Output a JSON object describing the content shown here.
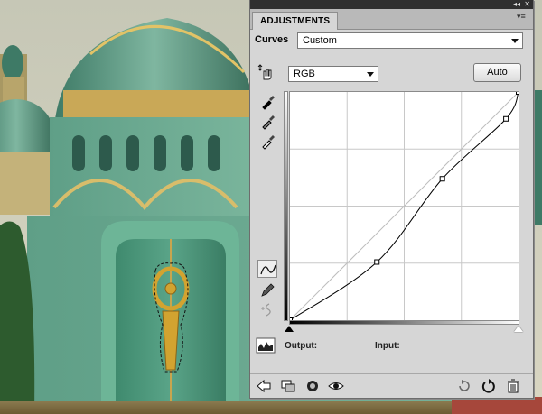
{
  "panel": {
    "tab_title": "ADJUSTMENTS",
    "collapse_glyph": "◂◂",
    "close_glyph": "✕",
    "menu_glyph": "▾≡",
    "preset_label": "Curves",
    "preset_value": "Custom",
    "channel_value": "RGB",
    "auto_label": "Auto",
    "output_label": "Output:",
    "output_value": "",
    "input_label": "Input:",
    "input_value": ""
  },
  "tools": [
    {
      "name": "on-image-adjust-tool",
      "icon": "hand-arrows-icon"
    },
    {
      "name": "black-point-eyedropper",
      "icon": "eyedropper-black-icon"
    },
    {
      "name": "gray-point-eyedropper",
      "icon": "eyedropper-gray-icon"
    },
    {
      "name": "white-point-eyedropper",
      "icon": "eyedropper-white-icon"
    },
    {
      "name": "curve-points-tool",
      "icon": "curve-icon",
      "active": true
    },
    {
      "name": "pencil-draw-tool",
      "icon": "pencil-icon"
    },
    {
      "name": "smooth-curve-tool",
      "icon": "smooth-icon",
      "disabled": true
    }
  ],
  "curve": {
    "input_range": [
      0,
      255
    ],
    "output_range": [
      0,
      255
    ],
    "grid_divisions": 4,
    "points": [
      [
        0,
        0
      ],
      [
        97,
        65
      ],
      [
        170,
        158
      ],
      [
        241,
        225
      ],
      [
        255,
        255
      ]
    ]
  },
  "footer_buttons": [
    "back-to-list-icon",
    "clip-to-layer-icon",
    "view-previous-icon",
    "visibility-eye-icon",
    "previous-state-icon",
    "reset-icon",
    "delete-icon"
  ],
  "colors": {
    "panel_bg": "#d6d6d6",
    "title_bar": "#2f2f2f",
    "curve": "#000000",
    "grid": "#c8c8c8"
  }
}
